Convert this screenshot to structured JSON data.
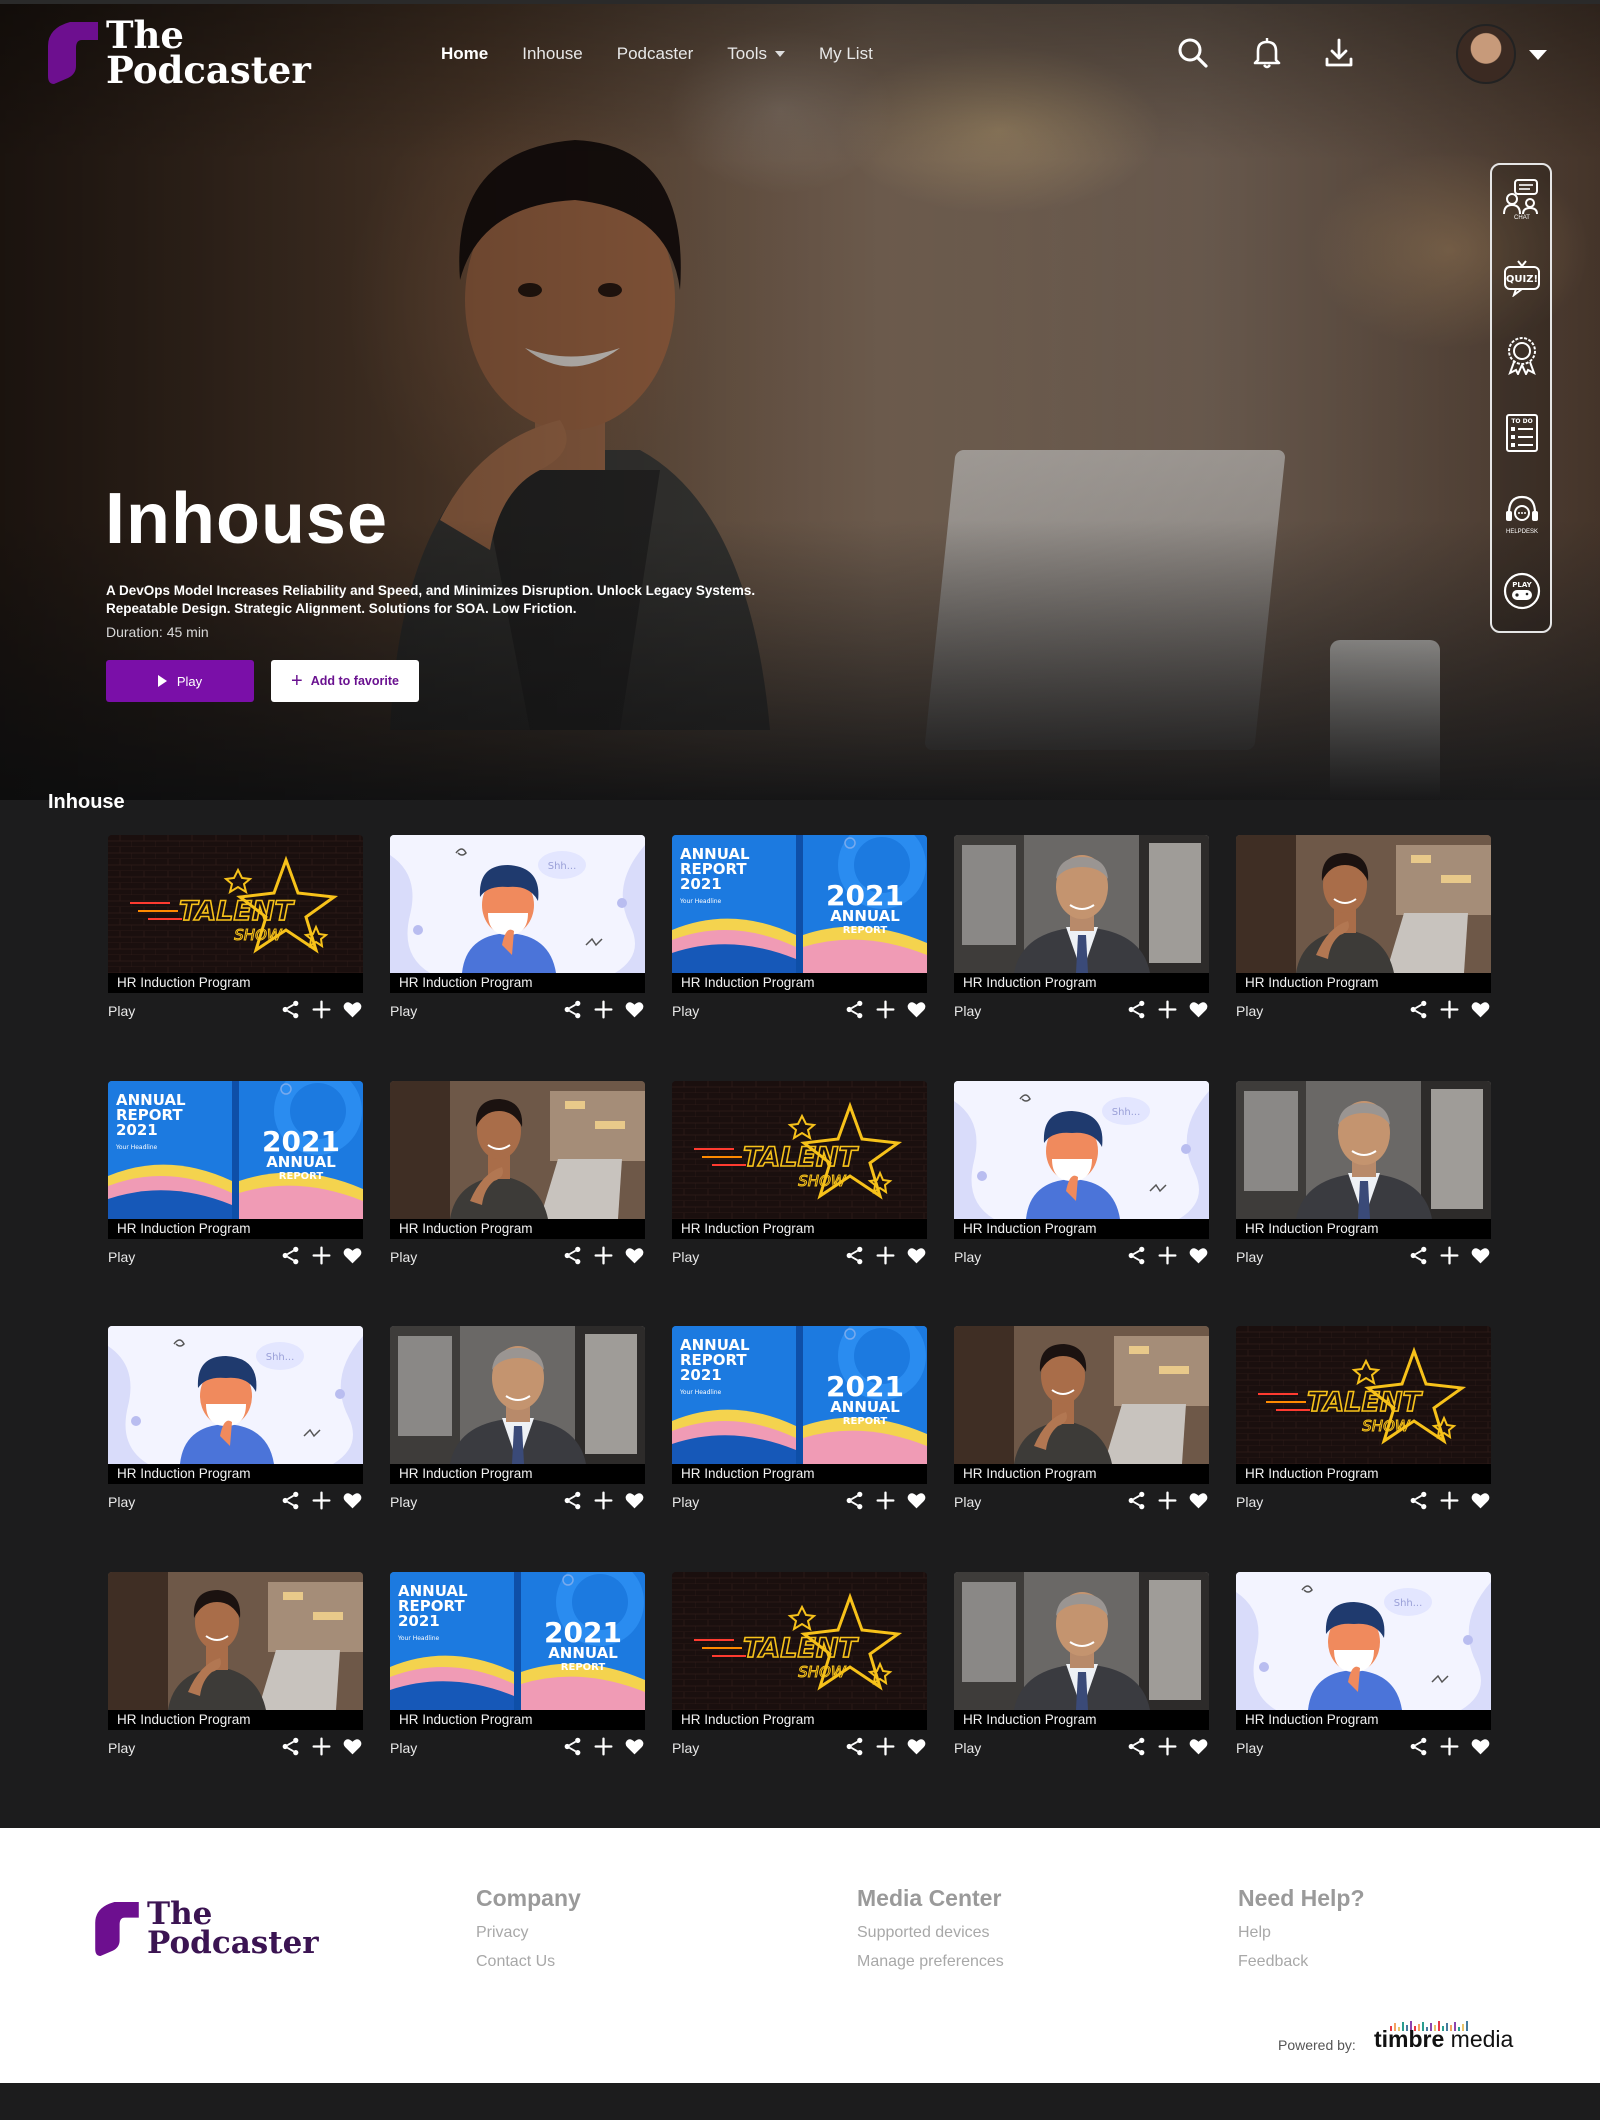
{
  "app": {
    "logo_line1": "The",
    "logo_line2": "Podcaster",
    "brand_color": "#7a0fa8"
  },
  "nav": {
    "items": [
      {
        "label": "Home",
        "active": true
      },
      {
        "label": "Inhouse"
      },
      {
        "label": "Podcaster"
      },
      {
        "label": "Tools",
        "has_dropdown": true
      },
      {
        "label": "My List"
      }
    ]
  },
  "header_icons": [
    "search-icon",
    "bell-icon",
    "download-icon"
  ],
  "side_tools": [
    {
      "icon": "chat-icon",
      "label": "CHAT"
    },
    {
      "icon": "quiz-icon",
      "label": "QUIZ!"
    },
    {
      "icon": "badge-icon",
      "label": "HALL OF FAME"
    },
    {
      "icon": "todo-icon",
      "label": "TO DO"
    },
    {
      "icon": "helpdesk-icon",
      "label": "HELPDESK"
    },
    {
      "icon": "game-icon",
      "label": "PLAY"
    }
  ],
  "hero": {
    "title": "Inhouse",
    "description": "A  DevOps Model Increases Reliability and  Speed, and Minimizes Disruption. Unlock  Legacy Systems. Repeatable Design.  Strategic Alignment. Solutions for SOA.  Low Friction.",
    "duration": "Duration: 45 min",
    "play_label": "Play",
    "favorite_label": "Add to favorite"
  },
  "section": {
    "title": "Inhouse"
  },
  "cards": [
    {
      "thumb": "talent",
      "caption": "HR Induction Program",
      "play": "Play"
    },
    {
      "thumb": "mask",
      "caption": "HR Induction Program",
      "play": "Play"
    },
    {
      "thumb": "report",
      "caption": "HR Induction Program",
      "play": "Play"
    },
    {
      "thumb": "man",
      "caption": "HR Induction Program",
      "play": "Play"
    },
    {
      "thumb": "woman",
      "caption": "HR Induction Program",
      "play": "Play"
    },
    {
      "thumb": "report",
      "caption": "HR Induction Program",
      "play": "Play"
    },
    {
      "thumb": "woman",
      "caption": "HR Induction Program",
      "play": "Play"
    },
    {
      "thumb": "talent",
      "caption": "HR Induction Program",
      "play": "Play"
    },
    {
      "thumb": "mask",
      "caption": "HR Induction Program",
      "play": "Play"
    },
    {
      "thumb": "man",
      "caption": "HR Induction Program",
      "play": "Play"
    },
    {
      "thumb": "mask",
      "caption": "HR Induction Program",
      "play": "Play"
    },
    {
      "thumb": "man",
      "caption": "HR Induction Program",
      "play": "Play"
    },
    {
      "thumb": "report",
      "caption": "HR Induction Program",
      "play": "Play"
    },
    {
      "thumb": "woman",
      "caption": "HR Induction Program",
      "play": "Play"
    },
    {
      "thumb": "talent",
      "caption": "HR Induction Program",
      "play": "Play"
    },
    {
      "thumb": "woman",
      "caption": "HR Induction Program",
      "play": "Play"
    },
    {
      "thumb": "report",
      "caption": "HR Induction Program",
      "play": "Play"
    },
    {
      "thumb": "talent",
      "caption": "HR Induction Program",
      "play": "Play"
    },
    {
      "thumb": "man",
      "caption": "HR Induction Program",
      "play": "Play"
    },
    {
      "thumb": "mask",
      "caption": "HR Induction Program",
      "play": "Play"
    }
  ],
  "thumb_text": {
    "talent_line1": "TALENT",
    "talent_line2": "SHOW",
    "report_left1": "ANNUAL",
    "report_left2": "REPORT",
    "report_left3": "2021",
    "report_sub": "Your Headline",
    "report_right1": "2021",
    "report_right2": "ANNUAL",
    "report_right3": "REPORT",
    "mask_bubble": "Shh..."
  },
  "footer": {
    "columns": [
      {
        "heading": "Company",
        "links": [
          "Privacy",
          "Contact Us"
        ]
      },
      {
        "heading": "Media Center",
        "links": [
          "Supported devices",
          "Manage preferences"
        ]
      },
      {
        "heading": "Need Help?",
        "links": [
          "Help",
          "Feedback"
        ]
      }
    ],
    "powered_by": "Powered by:",
    "partner_bold": "timbre",
    "partner_rest": " media"
  }
}
